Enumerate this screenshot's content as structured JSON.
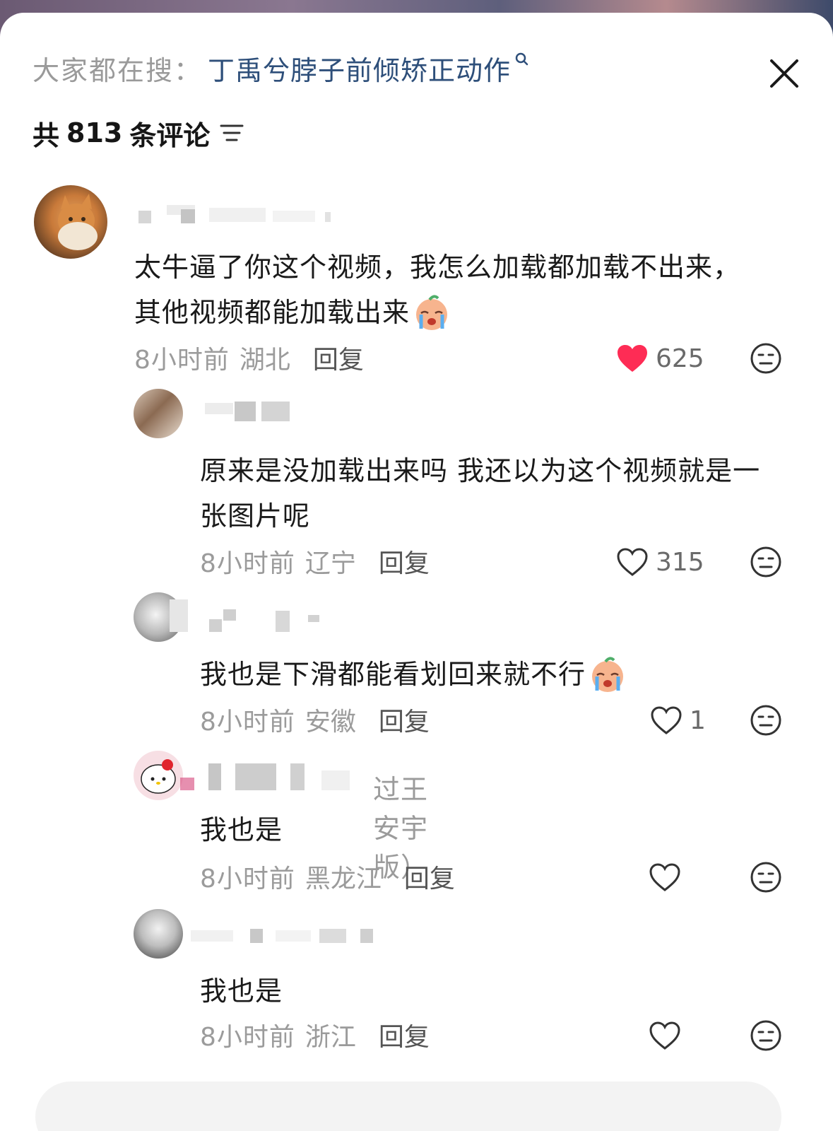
{
  "search": {
    "prefix": "大家都在搜：",
    "term": "丁禹兮脖子前倾矫正动作"
  },
  "header": {
    "count_prefix": "共",
    "count": "813",
    "count_suffix": "条评论"
  },
  "comments": [
    {
      "text_line1": "太牛逼了你这个视频，我怎么加载都加载不出来，",
      "text_line2": "其他视频都能加载出来",
      "emoji": "crying-face-emoji",
      "time": "8小时前",
      "location": "湖北",
      "reply": "回复",
      "likes": "625",
      "liked": true
    },
    {
      "text_line1": "原来是没加载出来吗 我还以为这个视频就是一",
      "text_line2": "张图片呢",
      "time": "8小时前",
      "location": "辽宁",
      "reply": "回复",
      "likes": "315",
      "liked": false
    },
    {
      "text_line1": "我也是下滑都能看划回来就不行",
      "emoji": "crying-face-emoji",
      "time": "8小时前",
      "location": "安徽",
      "reply": "回复",
      "likes": "1",
      "liked": false
    },
    {
      "username_visible": "过王安宇版）",
      "text_line1": "我也是",
      "time": "8小时前",
      "location": "黑龙江",
      "reply": "回复",
      "likes": "",
      "liked": false
    },
    {
      "text_line1": "我也是",
      "time": "8小时前",
      "location": "浙江",
      "reply": "回复",
      "likes": "",
      "liked": false
    }
  ],
  "colors": {
    "accent_like": "#fe2c55",
    "search_term": "#2e4f7a"
  }
}
